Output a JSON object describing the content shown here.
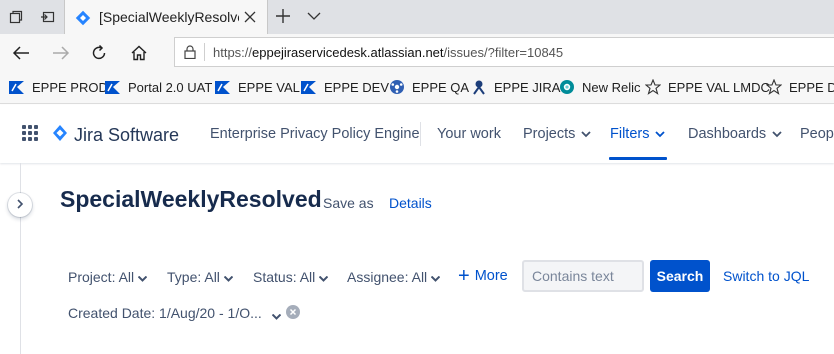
{
  "browser": {
    "tab": {
      "title": "[SpecialWeeklyResolved"
    },
    "address": {
      "protocol": "https://",
      "host": "eppejiraservicedesk.atlassian.net",
      "path": "/issues/?filter=10845"
    }
  },
  "bookmarks": [
    {
      "label": "EPPE PROD",
      "icon": "jira-flag-icon"
    },
    {
      "label": "Portal 2.0 UAT",
      "icon": "jira-flag-icon"
    },
    {
      "label": "EPPE VAL",
      "icon": "jira-flag-icon"
    },
    {
      "label": "EPPE DEV",
      "icon": "jira-flag-icon"
    },
    {
      "label": "EPPE QA",
      "icon": "globe-icon"
    },
    {
      "label": "EPPE JIRA",
      "icon": "gear-jira-icon"
    },
    {
      "label": "New Relic",
      "icon": "new-relic-icon"
    },
    {
      "label": "EPPE VAL LMDC",
      "icon": "star-icon"
    },
    {
      "label": "EPPE DE",
      "icon": "star-icon"
    }
  ],
  "jira_nav": {
    "product": "Jira Software",
    "project": "Enterprise Privacy Policy Engine",
    "items": [
      {
        "label": "Your work"
      },
      {
        "label": "Projects"
      },
      {
        "label": "Filters"
      },
      {
        "label": "Dashboards"
      },
      {
        "label": "People"
      }
    ],
    "accent": "#0052CC"
  },
  "filter_page": {
    "title": "SpecialWeeklyResolved",
    "save_as": "Save as",
    "details": "Details",
    "filters": [
      {
        "label": "Project: All"
      },
      {
        "label": "Type: All"
      },
      {
        "label": "Status: All"
      },
      {
        "label": "Assignee: All"
      }
    ],
    "more": "More",
    "text_search_placeholder": "Contains text",
    "search_button": "Search",
    "switch_jql": "Switch to JQL",
    "created_date": "Created Date: 1/Aug/20 - 1/O..."
  }
}
